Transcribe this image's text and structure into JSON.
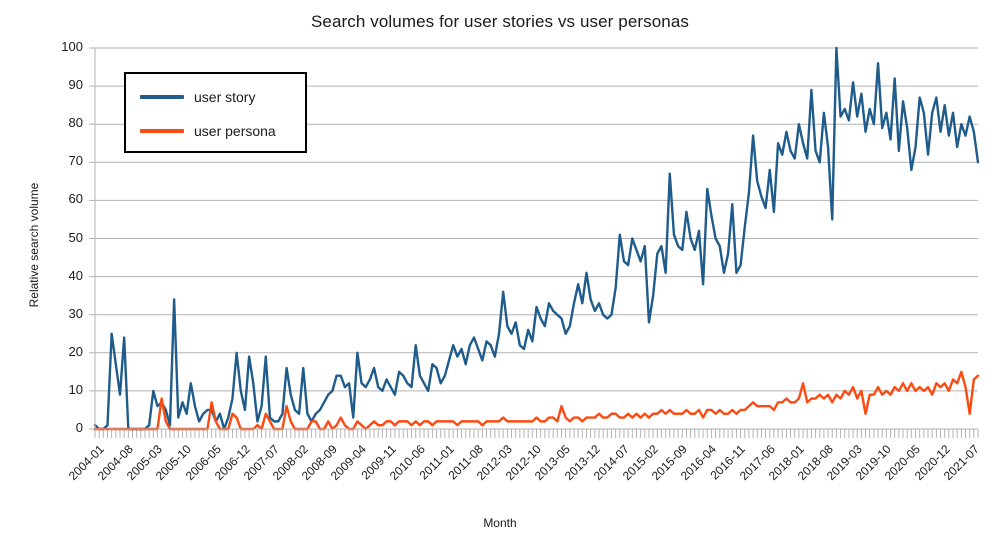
{
  "chart": {
    "title": "Search volumes for user stories vs user personas",
    "xlabel": "Month",
    "ylabel": "Relative search volume"
  },
  "legend": {
    "position": "top-left-inside",
    "entries": [
      {
        "label": "user story",
        "color": "#1F5C8B"
      },
      {
        "label": "user persona",
        "color": "#FB4B12"
      }
    ]
  },
  "axes": {
    "y_ticks": [
      "0",
      "10",
      "20",
      "30",
      "40",
      "50",
      "60",
      "70",
      "80",
      "90",
      "100"
    ],
    "x_tick_labels": [
      "2004-01",
      "2004-08",
      "2005-03",
      "2005-10",
      "2006-05",
      "2006-12",
      "2007-07",
      "2008-02",
      "2008-09",
      "2009-04",
      "2009-11",
      "2010-06",
      "2011-01",
      "2011-08",
      "2012-03",
      "2012-10",
      "2013-05",
      "2013-12",
      "2014-07",
      "2015-02",
      "2015-09",
      "2016-04",
      "2016-11",
      "2017-06",
      "2018-01",
      "2018-08",
      "2019-03",
      "2019-10",
      "2020-05",
      "2020-12",
      "2021-07"
    ]
  },
  "chart_data": {
    "type": "line",
    "title": "Search volumes for user stories vs user personas",
    "xlabel": "Month",
    "ylabel": "Relative search volume",
    "ylim": [
      0,
      100
    ],
    "ytick_step": 10,
    "grid": "horizontal",
    "legend_position": "upper left",
    "x_tick_every": 7,
    "x_start": "2004-01",
    "x_end": "2021-09",
    "x": [
      "2004-01",
      "2004-02",
      "2004-03",
      "2004-04",
      "2004-05",
      "2004-06",
      "2004-07",
      "2004-08",
      "2004-09",
      "2004-10",
      "2004-11",
      "2004-12",
      "2005-01",
      "2005-02",
      "2005-03",
      "2005-04",
      "2005-05",
      "2005-06",
      "2005-07",
      "2005-08",
      "2005-09",
      "2005-10",
      "2005-11",
      "2005-12",
      "2006-01",
      "2006-02",
      "2006-03",
      "2006-04",
      "2006-05",
      "2006-06",
      "2006-07",
      "2006-08",
      "2006-09",
      "2006-10",
      "2006-11",
      "2006-12",
      "2007-01",
      "2007-02",
      "2007-03",
      "2007-04",
      "2007-05",
      "2007-06",
      "2007-07",
      "2007-08",
      "2007-09",
      "2007-10",
      "2007-11",
      "2007-12",
      "2008-01",
      "2008-02",
      "2008-03",
      "2008-04",
      "2008-05",
      "2008-06",
      "2008-07",
      "2008-08",
      "2008-09",
      "2008-10",
      "2008-11",
      "2008-12",
      "2009-01",
      "2009-02",
      "2009-03",
      "2009-04",
      "2009-05",
      "2009-06",
      "2009-07",
      "2009-08",
      "2009-09",
      "2009-10",
      "2009-11",
      "2009-12",
      "2010-01",
      "2010-02",
      "2010-03",
      "2010-04",
      "2010-05",
      "2010-06",
      "2010-07",
      "2010-08",
      "2010-09",
      "2010-10",
      "2010-11",
      "2010-12",
      "2011-01",
      "2011-02",
      "2011-03",
      "2011-04",
      "2011-05",
      "2011-06",
      "2011-07",
      "2011-08",
      "2011-09",
      "2011-10",
      "2011-11",
      "2011-12",
      "2012-01",
      "2012-02",
      "2012-03",
      "2012-04",
      "2012-05",
      "2012-06",
      "2012-07",
      "2012-08",
      "2012-09",
      "2012-10",
      "2012-11",
      "2012-12",
      "2013-01",
      "2013-02",
      "2013-03",
      "2013-04",
      "2013-05",
      "2013-06",
      "2013-07",
      "2013-08",
      "2013-09",
      "2013-10",
      "2013-11",
      "2013-12",
      "2014-01",
      "2014-02",
      "2014-03",
      "2014-04",
      "2014-05",
      "2014-06",
      "2014-07",
      "2014-08",
      "2014-09",
      "2014-10",
      "2014-11",
      "2014-12",
      "2015-01",
      "2015-02",
      "2015-03",
      "2015-04",
      "2015-05",
      "2015-06",
      "2015-07",
      "2015-08",
      "2015-09",
      "2015-10",
      "2015-11",
      "2015-12",
      "2016-01",
      "2016-02",
      "2016-03",
      "2016-04",
      "2016-05",
      "2016-06",
      "2016-07",
      "2016-08",
      "2016-09",
      "2016-10",
      "2016-11",
      "2016-12",
      "2017-01",
      "2017-02",
      "2017-03",
      "2017-04",
      "2017-05",
      "2017-06",
      "2017-07",
      "2017-08",
      "2017-09",
      "2017-10",
      "2017-11",
      "2017-12",
      "2018-01",
      "2018-02",
      "2018-03",
      "2018-04",
      "2018-05",
      "2018-06",
      "2018-07",
      "2018-08",
      "2018-09",
      "2018-10",
      "2018-11",
      "2018-12",
      "2019-01",
      "2019-02",
      "2019-03",
      "2019-04",
      "2019-05",
      "2019-06",
      "2019-07",
      "2019-08",
      "2019-09",
      "2019-10",
      "2019-11",
      "2019-12",
      "2020-01",
      "2020-02",
      "2020-03",
      "2020-04",
      "2020-05",
      "2020-06",
      "2020-07",
      "2020-08",
      "2020-09",
      "2020-10",
      "2020-11",
      "2020-12",
      "2021-01",
      "2021-02",
      "2021-03",
      "2021-04",
      "2021-05",
      "2021-06",
      "2021-07",
      "2021-08",
      "2021-09"
    ],
    "series": [
      {
        "name": "user story",
        "color": "#1F5C8B",
        "values": [
          1,
          0,
          0,
          1,
          25,
          17,
          9,
          24,
          0,
          0,
          0,
          0,
          0,
          1,
          10,
          6,
          7,
          5,
          1,
          34,
          3,
          7,
          4,
          12,
          6,
          2,
          4,
          5,
          5,
          2,
          4,
          0,
          3,
          8,
          20,
          10,
          5,
          19,
          12,
          2,
          6,
          19,
          3,
          2,
          2,
          4,
          16,
          9,
          5,
          4,
          16,
          4,
          2,
          4,
          5,
          7,
          9,
          10,
          14,
          14,
          11,
          12,
          3,
          20,
          12,
          11,
          13,
          16,
          11,
          10,
          13,
          11,
          9,
          15,
          14,
          12,
          11,
          22,
          14,
          12,
          10,
          17,
          16,
          12,
          14,
          18,
          22,
          19,
          21,
          17,
          22,
          24,
          21,
          18,
          23,
          22,
          19,
          25,
          36,
          27,
          25,
          28,
          22,
          21,
          26,
          23,
          32,
          29,
          27,
          33,
          31,
          30,
          29,
          25,
          27,
          33,
          38,
          33,
          41,
          34,
          31,
          33,
          30,
          29,
          30,
          37,
          51,
          44,
          43,
          50,
          47,
          44,
          48,
          28,
          35,
          46,
          48,
          41,
          67,
          51,
          48,
          47,
          57,
          50,
          47,
          52,
          38,
          63,
          56,
          50,
          48,
          41,
          46,
          59,
          41,
          43,
          53,
          62,
          77,
          65,
          61,
          58,
          68,
          57,
          75,
          72,
          78,
          73,
          71,
          80,
          75,
          71,
          89,
          73,
          70,
          83,
          74,
          55,
          100,
          82,
          84,
          81,
          91,
          82,
          88,
          78,
          84,
          80,
          96,
          79,
          83,
          76,
          92,
          73,
          86,
          79,
          68,
          74,
          87,
          83,
          72,
          83,
          87,
          78,
          85,
          77,
          83,
          74,
          80,
          77,
          82,
          78,
          70
        ]
      },
      {
        "name": "user persona",
        "color": "#FB4B12",
        "values": [
          0,
          0,
          0,
          0,
          0,
          0,
          0,
          0,
          0,
          0,
          0,
          0,
          0,
          0,
          0,
          0,
          8,
          2,
          0,
          0,
          0,
          0,
          0,
          0,
          0,
          0,
          0,
          0,
          7,
          2,
          0,
          0,
          0,
          4,
          3,
          0,
          0,
          0,
          0,
          1,
          0,
          4,
          2,
          0,
          0,
          0,
          6,
          2,
          0,
          0,
          0,
          0,
          2,
          2,
          0,
          0,
          2,
          0,
          1,
          3,
          1,
          0,
          0,
          2,
          1,
          0,
          1,
          2,
          1,
          1,
          2,
          2,
          1,
          2,
          2,
          2,
          1,
          2,
          1,
          2,
          2,
          1,
          2,
          2,
          2,
          2,
          2,
          1,
          2,
          2,
          2,
          2,
          2,
          1,
          2,
          2,
          2,
          2,
          3,
          2,
          2,
          2,
          2,
          2,
          2,
          2,
          3,
          2,
          2,
          3,
          3,
          2,
          6,
          3,
          2,
          3,
          3,
          2,
          3,
          3,
          3,
          4,
          3,
          3,
          4,
          4,
          3,
          3,
          4,
          3,
          4,
          3,
          4,
          3,
          4,
          4,
          5,
          4,
          5,
          4,
          4,
          4,
          5,
          4,
          4,
          5,
          3,
          5,
          5,
          4,
          5,
          4,
          4,
          5,
          4,
          5,
          5,
          6,
          7,
          6,
          6,
          6,
          6,
          5,
          7,
          7,
          8,
          7,
          7,
          8,
          12,
          7,
          8,
          8,
          9,
          8,
          9,
          7,
          9,
          8,
          10,
          9,
          11,
          8,
          10,
          4,
          9,
          9,
          11,
          9,
          10,
          9,
          11,
          10,
          12,
          10,
          12,
          10,
          11,
          10,
          11,
          9,
          12,
          11,
          12,
          10,
          13,
          12,
          15,
          11,
          4,
          13,
          14
        ]
      }
    ]
  }
}
